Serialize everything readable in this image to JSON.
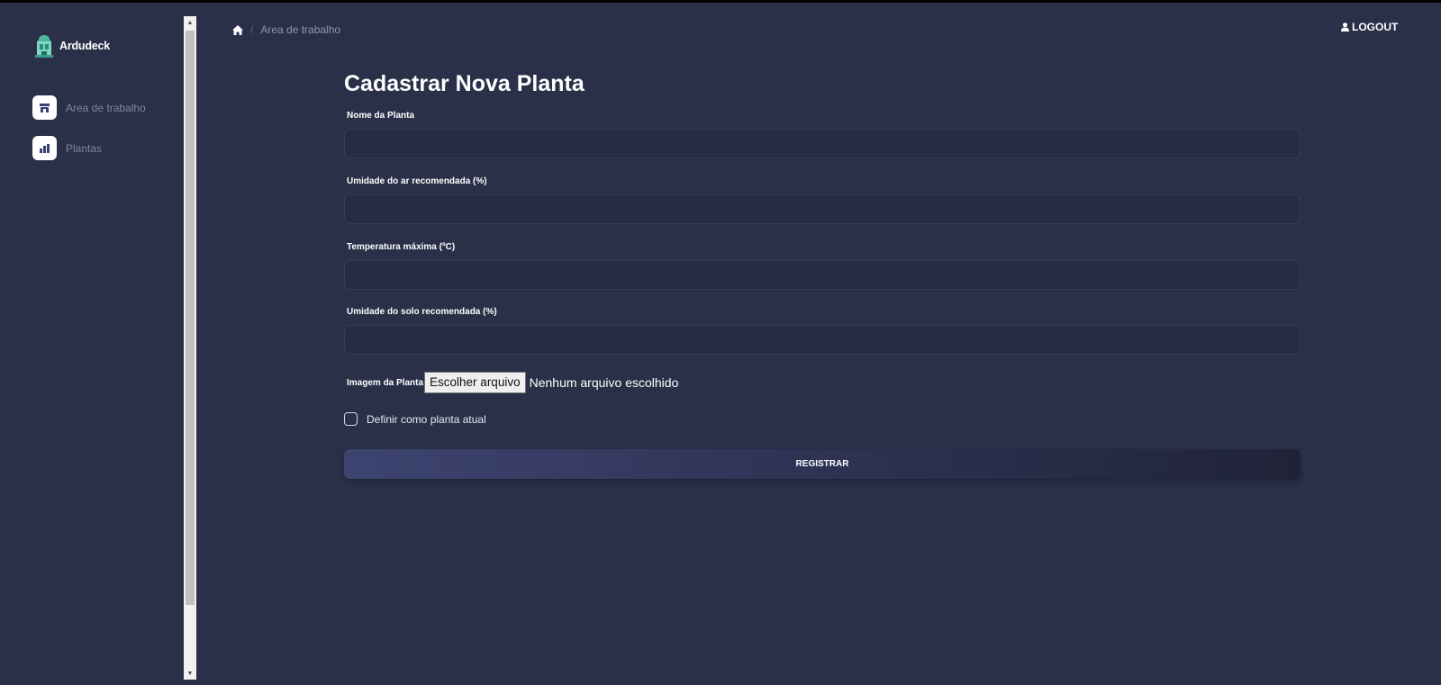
{
  "app": {
    "brand_name": "Ardudeck"
  },
  "sidebar": {
    "items": [
      {
        "label": "Area de trabalho",
        "icon": "store-icon"
      },
      {
        "label": "Plantas",
        "icon": "chart-icon"
      }
    ]
  },
  "header": {
    "breadcrumb_current": "Area de trabalho",
    "breadcrumb_separator": "/",
    "logout_label": "LOGOUT"
  },
  "form": {
    "title": "Cadastrar Nova Planta",
    "fields": [
      {
        "label": "Nome da Planta",
        "value": ""
      },
      {
        "label": "Umidade do ar recomendada (%)",
        "value": ""
      },
      {
        "label": "Temperatura máxima (ºC)",
        "value": ""
      },
      {
        "label": "Umidade do solo recomendada (%)",
        "value": ""
      }
    ],
    "image_label": "Imagem da Planta",
    "file_button_label": "Escolher arquivo",
    "file_status": "Nenhum arquivo escolhido",
    "checkbox_label": "Definir como planta atual",
    "checkbox_checked": false,
    "submit_label": "REGISTRAR"
  },
  "colors": {
    "background": "#293048",
    "input_background": "#252c44",
    "accent_gradient_start": "#3d4470",
    "accent_gradient_end": "#202338"
  }
}
